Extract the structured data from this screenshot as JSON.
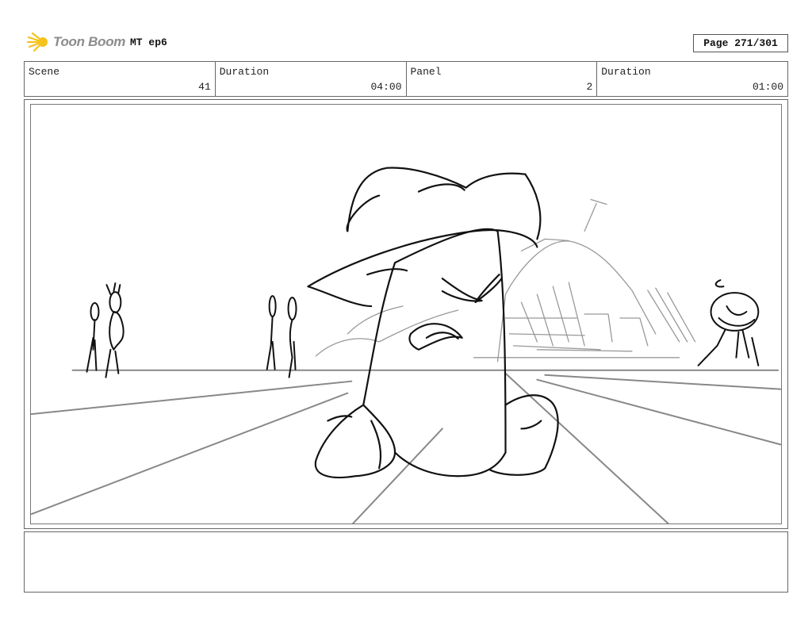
{
  "header": {
    "logo_text": "Toon Boom",
    "project": "MT ep6",
    "page": "Page 271/301"
  },
  "info": [
    {
      "label": "Scene",
      "value": "41"
    },
    {
      "label": "Duration",
      "value": "04:00"
    },
    {
      "label": "Panel",
      "value": "2"
    },
    {
      "label": "Duration",
      "value": "01:00"
    }
  ],
  "panel": {
    "icon": "storyboard-sketch-image"
  },
  "notes": {
    "text": ""
  },
  "colors": {
    "logo_accent": "#f6c21c",
    "logo_text": "#8c8c8c",
    "border": "#666666"
  }
}
